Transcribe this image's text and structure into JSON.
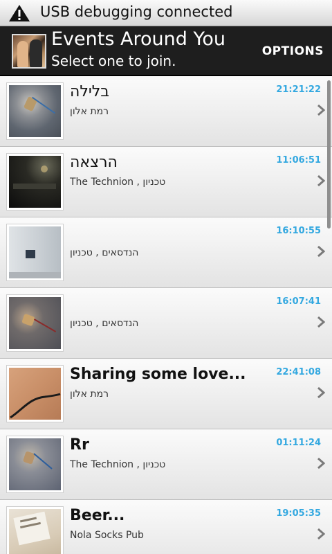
{
  "status_bar": {
    "text": "USB debugging connected",
    "icon": "warning-icon"
  },
  "title_bar": {
    "title": "Events Around You",
    "subtitle": "Select one to join.",
    "options_label": "OPTIONS"
  },
  "events": [
    {
      "title": "בלילה",
      "location": "רמת אלון",
      "time": "21:21:22"
    },
    {
      "title": "הרצאה",
      "location": "The Technion , טכניון",
      "time": "11:06:51"
    },
    {
      "title": "",
      "location": "הנדסאים , טכניון",
      "time": "16:10:55"
    },
    {
      "title": "",
      "location": "הנדסאים , טכניון",
      "time": "16:07:41"
    },
    {
      "title": "Sharing some love...",
      "location": "רמת אלון",
      "time": "22:41:08"
    },
    {
      "title": "Rr",
      "location": "The Technion , טכניון",
      "time": "01:11:24"
    },
    {
      "title": "Beer...",
      "location": "Nola Socks Pub",
      "time": "19:05:35"
    }
  ],
  "colors": {
    "time_accent": "#33a8e0",
    "title_bar_bg": "#1e1e1e"
  }
}
